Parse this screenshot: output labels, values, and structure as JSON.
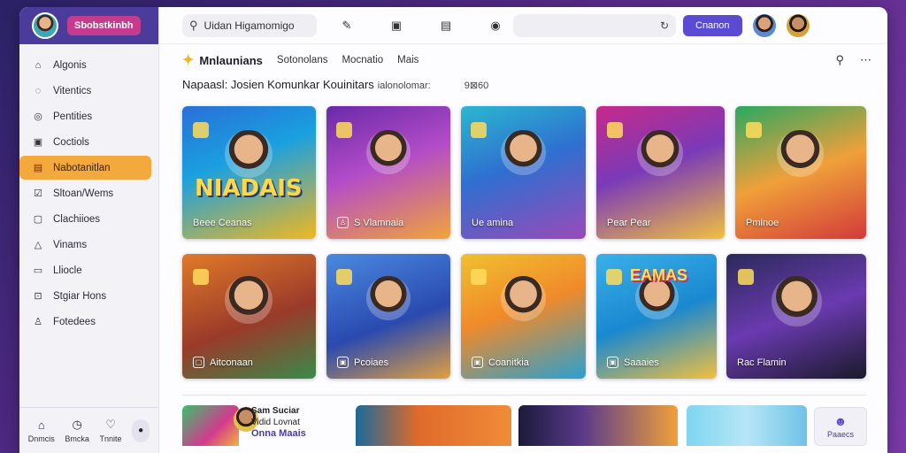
{
  "sidebar": {
    "brand_label": "Sbobstkinbh",
    "items": [
      {
        "icon": "home-icon",
        "glyph": "⌂",
        "label": "Algonis"
      },
      {
        "icon": "chat-icon",
        "glyph": "◌",
        "label": "Vitentics"
      },
      {
        "icon": "compass-icon",
        "glyph": "◎",
        "label": "Pentities"
      },
      {
        "icon": "box-icon",
        "glyph": "▣",
        "label": "Coctiols"
      },
      {
        "icon": "folder-icon",
        "glyph": "▤",
        "label": "Nabotanitlan",
        "active": true
      },
      {
        "icon": "check-icon",
        "glyph": "☑",
        "label": "Sltoan/Wems"
      },
      {
        "icon": "grid-icon",
        "glyph": "▢",
        "label": "Clachiioes"
      },
      {
        "icon": "warning-icon",
        "glyph": "△",
        "label": "Vinams"
      },
      {
        "icon": "tray-icon",
        "glyph": "▭",
        "label": "Lliocle"
      },
      {
        "icon": "stats-icon",
        "glyph": "⊡",
        "label": "Stgiar Hons"
      },
      {
        "icon": "bell-icon",
        "glyph": "♙",
        "label": "Fotedees"
      }
    ],
    "bottom": [
      {
        "icon": "house-icon",
        "glyph": "⌂",
        "label": "Dnmcis"
      },
      {
        "icon": "clock-icon",
        "glyph": "◷",
        "label": "Bmcka"
      },
      {
        "icon": "heart-icon",
        "glyph": "♡",
        "label": "Tnnite"
      }
    ],
    "toggle_glyph": "●"
  },
  "topbar": {
    "search_text": "Uidan Higamomigo",
    "icons": [
      "clipboard-icon",
      "square-icon",
      "lock-icon"
    ],
    "button_label": "Cnanon"
  },
  "subbar": {
    "title": "Mnlaunians",
    "links": [
      "Sotonolans",
      "Mocnatio",
      "Mais"
    ]
  },
  "headline": {
    "text": "Napaasl: Josien Komunkar Kouinitars",
    "muted": "ialonolomar:",
    "count": "9⊠60"
  },
  "cards": [
    {
      "label": "Beee Ceanas",
      "icon": ""
    },
    {
      "label": "S Vlamnaia",
      "icon": "♙"
    },
    {
      "label": "Ue amina",
      "icon": ""
    },
    {
      "label": "Pear Pear",
      "icon": ""
    },
    {
      "label": "Pmlnoe",
      "icon": ""
    },
    {
      "label": "Aitconaan",
      "icon": "▢"
    },
    {
      "label": "Pcoiaes",
      "icon": "▣"
    },
    {
      "label": "Coanitkia",
      "icon": "▣"
    },
    {
      "label": "Saaaies",
      "icon": "▣"
    },
    {
      "label": "Rac Flamin",
      "icon": ""
    }
  ],
  "cover_title": "NIADAIS",
  "cover_badge": "EAMAS",
  "strip": {
    "name": "Sam Suciar",
    "sub": "Vidid Lovnat",
    "tag": "Onna Maais",
    "message_label": "Paaecs"
  }
}
